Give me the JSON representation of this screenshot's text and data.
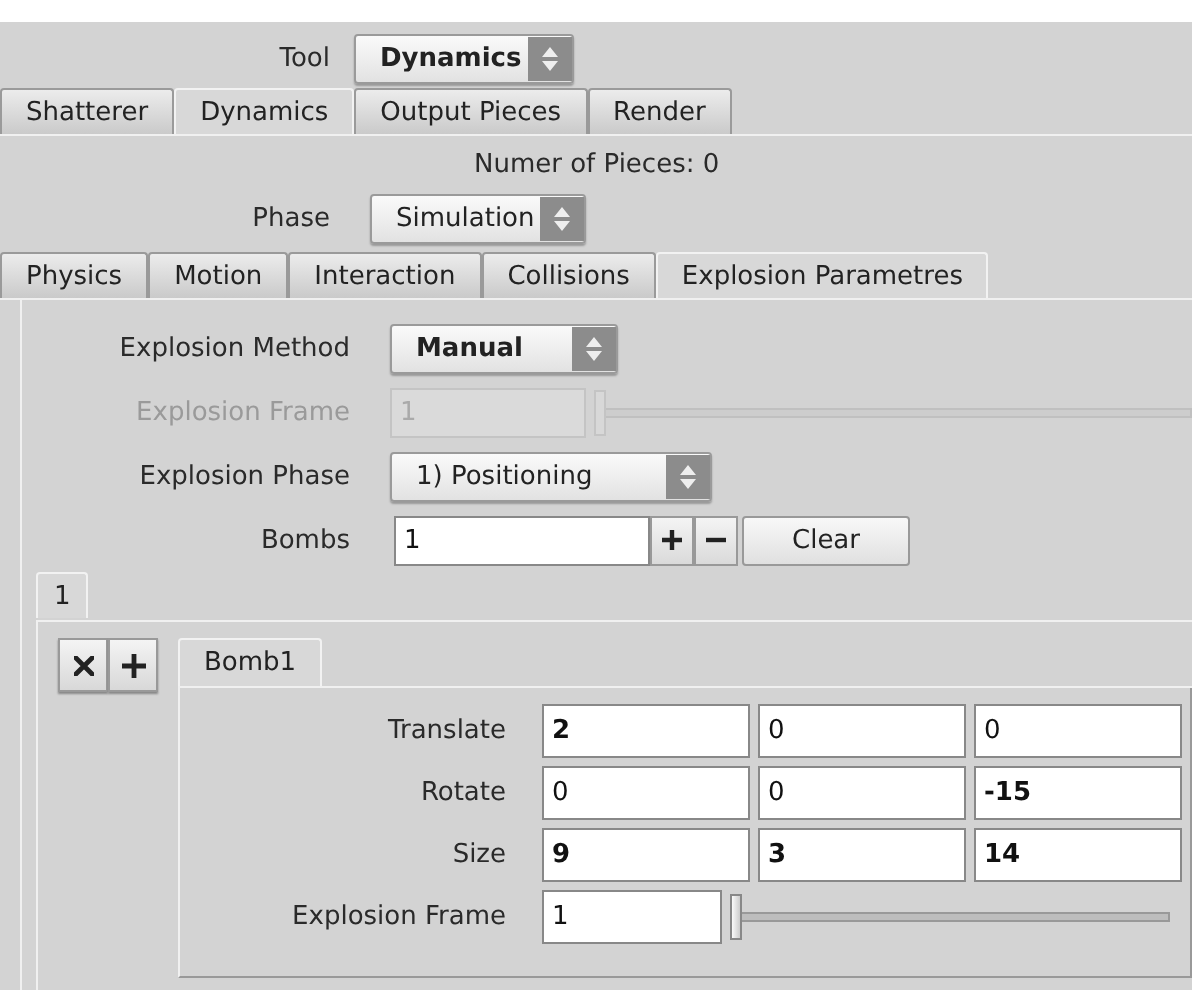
{
  "tool": {
    "label": "Tool",
    "value": "Dynamics",
    "modified": true
  },
  "main_tabs": [
    {
      "label": "Shatterer",
      "selected": false
    },
    {
      "label": "Dynamics",
      "selected": true
    },
    {
      "label": "Output Pieces",
      "selected": false
    },
    {
      "label": "Render",
      "selected": false
    }
  ],
  "pieces_count": "Numer of Pieces: 0",
  "phase": {
    "label": "Phase",
    "value": "Simulation",
    "modified": false
  },
  "sub_tabs": [
    {
      "label": "Physics",
      "selected": false
    },
    {
      "label": "Motion",
      "selected": false
    },
    {
      "label": "Interaction",
      "selected": false
    },
    {
      "label": "Collisions",
      "selected": false
    },
    {
      "label": "Explosion Parametres",
      "selected": true
    }
  ],
  "parameters": [
    {
      "kind": "dropdown",
      "label": "Explosion Method",
      "value": "Manual",
      "modified": true,
      "disabled": false
    },
    {
      "kind": "slider",
      "label": "Explosion Frame",
      "value": "1",
      "level": 0,
      "disabled": true
    },
    {
      "kind": "dropdown",
      "label": "Explosion Phase",
      "value": "1) Positioning",
      "modified": false,
      "disabled": false
    },
    {
      "kind": "counter",
      "label": "Bombs",
      "value": "1",
      "clear": "Clear",
      "disabled": false
    }
  ],
  "bomb_tabs": [
    {
      "label": "1",
      "selected": true
    }
  ],
  "bomb_subtabs": [
    {
      "label": "Bomb1",
      "selected": true
    }
  ],
  "transform": [
    {
      "label": "Translate",
      "values": [
        {
          "value": "2",
          "modified": true
        },
        {
          "value": "0",
          "modified": false
        },
        {
          "value": "0",
          "modified": false
        }
      ]
    },
    {
      "label": "Rotate",
      "values": [
        {
          "value": "0",
          "modified": false
        },
        {
          "value": "0",
          "modified": false
        },
        {
          "value": "-15",
          "modified": true
        }
      ]
    },
    {
      "label": "Size",
      "values": [
        {
          "value": "9",
          "modified": true
        },
        {
          "value": "3",
          "modified": true
        },
        {
          "value": "14",
          "modified": true
        }
      ]
    }
  ],
  "frame": {
    "label": "Explosion Frame",
    "value": "1",
    "level": 0
  }
}
